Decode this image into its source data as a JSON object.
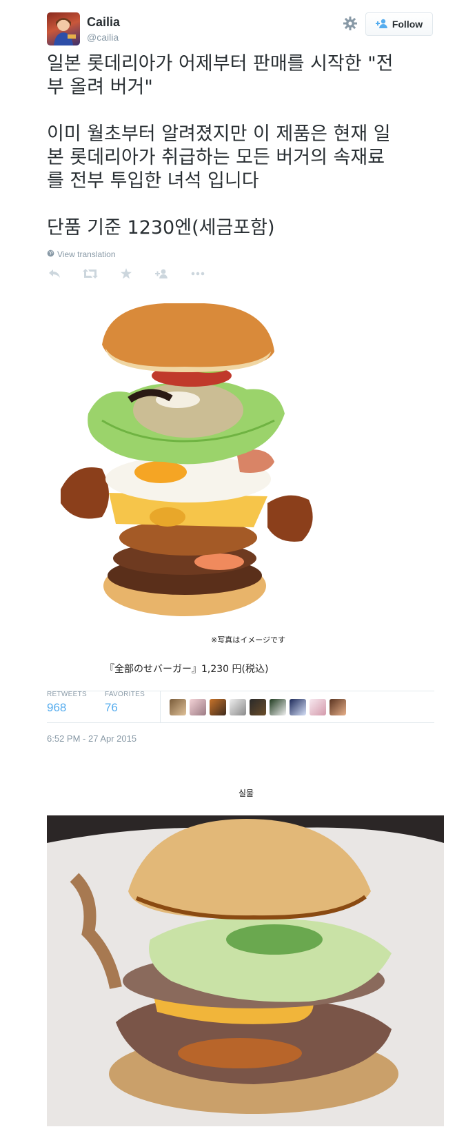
{
  "user": {
    "name": "Cailia",
    "handle": "@cailia"
  },
  "header": {
    "follow_label": "Follow",
    "settings_icon": "gear-icon",
    "follow_icon": "add-user-icon"
  },
  "tweet": {
    "text": "일본 롯데리아가 어제부터 판매를 시작한 \"전\n부 올려 버거\"\n\n이미 월초부터 알려졌지만 이 제품은 현재 일\n본 롯데리아가 취급하는 모든 버거의 속재료\n를 전부 투입한 녀석 입니다\n\n단품 기준 1230엔(세금포함)",
    "view_translation": "View translation",
    "actions": [
      "reply-icon",
      "retweet-icon",
      "favorite-icon",
      "follow-icon",
      "more-icon"
    ]
  },
  "media": {
    "note": "※写真はイメージです",
    "caption": "『全部のせバーガー』1,230 円(税込)"
  },
  "stats": {
    "retweets_label": "RETWEETS",
    "retweets_value": "968",
    "favorites_label": "FAVORITES",
    "favorites_value": "76"
  },
  "timestamp": "6:52 PM - 27 Apr 2015",
  "real_label": "실물",
  "colors": {
    "accent": "#55acee",
    "muted": "#8899a6",
    "text": "#292f33",
    "border": "#e1e8ed"
  }
}
